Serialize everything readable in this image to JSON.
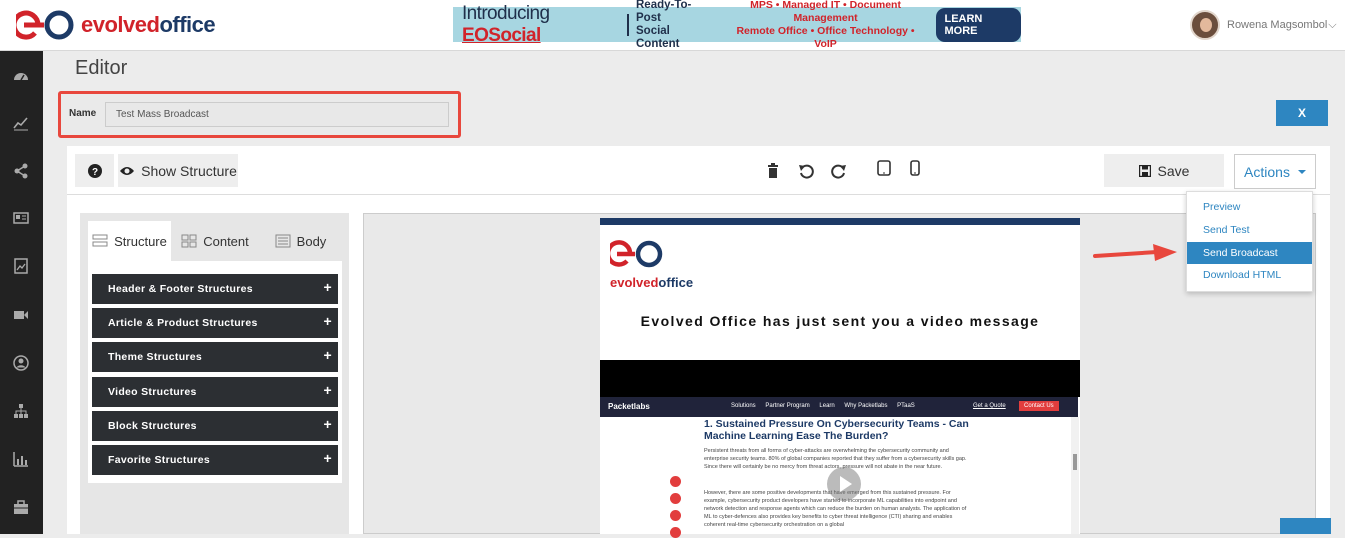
{
  "header": {
    "logo_part1": "evolved",
    "logo_part2": "office",
    "banner": {
      "intro": "Introducing ",
      "brand": "EOSocial",
      "mid_line1": "Ready-To-Post",
      "mid_line2": "Social Content",
      "right_line1": "MPS • Managed IT • Document Management",
      "right_line2": "Remote Office • Office Technology • VoIP",
      "cta": "LEARN MORE"
    },
    "user_name": "Rowena Magsombol",
    "user_caret": "⌵"
  },
  "sidebar": {
    "icons": [
      "dashboard-icon",
      "chart-line-icon",
      "share-icon",
      "newspaper-icon",
      "image-icon",
      "video-icon",
      "user-circle-icon",
      "sitemap-icon",
      "bar-chart-icon",
      "briefcase-icon"
    ]
  },
  "page": {
    "title": "Editor",
    "name_label": "Name",
    "name_value": "Test Mass Broadcast",
    "close_label": "X"
  },
  "toolbar": {
    "help_label": "?",
    "show_structure_label": "Show Structure",
    "save_label": "Save",
    "actions_label": "Actions"
  },
  "actions_menu": {
    "items": [
      "Preview",
      "Send Test",
      "Send Broadcast",
      "Download HTML"
    ],
    "active": "Send Broadcast"
  },
  "left_panel": {
    "tabs": [
      "Structure",
      "Content",
      "Body"
    ],
    "active_tab": "Structure",
    "structures": [
      "Header & Footer Structures",
      "Article & Product Structures",
      "Theme Structures",
      "Video Structures",
      "Block Structures",
      "Favorite Structures"
    ],
    "plus": "+"
  },
  "email": {
    "logo_part1": "evolved",
    "logo_part2": "office",
    "heading": "Evolved Office has just sent you a video message",
    "video_site": {
      "logo": "Packetlabs",
      "nav": [
        "Solutions",
        "Partner Program",
        "Learn",
        "Why Packetlabs",
        "PTaaS"
      ],
      "quote": "Get a Quote",
      "contact": "Contact Us",
      "title": "1. Sustained Pressure On Cybersecurity Teams - Can Machine Learning Ease The Burden?",
      "para1": "Persistent threats from all forms of cyber-attacks are overwhelming the cybersecurity community and enterprise security teams. 80% of global companies reported that they suffer from a cybersecurity skills gap. Since there will certainly be no mercy from threat actors, pressure will not abate in the near future.",
      "para2": "However, there are some positive developments that have emerged from this sustained pressure. For example, cybersecurity product developers have started to incorporate ML capabilities into endpoint and network detection and response agents which can reduce the burden on human analysts. The application of ML to cyber-defences also provides key benefits to cyber threat intelligence (CTI) sharing and enables coherent real-time cybersecurity orchestration on a global"
    }
  },
  "colors": {
    "brand_red": "#d1232a",
    "brand_navy": "#1d3a66",
    "accent_blue": "#2e86c1",
    "highlight_red": "#e8473d"
  }
}
